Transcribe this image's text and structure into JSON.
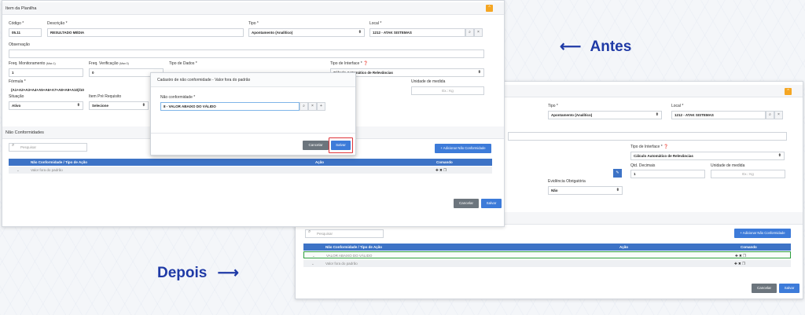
{
  "annotations": {
    "antes": "Antes",
    "depois": "Depois"
  },
  "before": {
    "section_title": "Item da Planilha",
    "labels": {
      "codigo": "Código *",
      "descricao": "Descrição *",
      "tipo": "Tipo *",
      "local": "Local *",
      "observacao": "Observação",
      "freq_monitoramento": "Freq. Monitoramento",
      "freq_monitoramento_hint": "(Max 1)",
      "freq_verificacao": "Freq. Verificação",
      "freq_verificacao_hint": "(Max 0)",
      "tipo_dados": "Tipo de Dados *",
      "tipo_interface": "Tipo de Interface *",
      "formula": "Fórmula *",
      "unidade_medida": "Unidade de medida",
      "situacao": "Situação",
      "item_pre_requisito": "Item Pré Requisito"
    },
    "values": {
      "codigo": "05.11",
      "descricao": "RESULTADO MÉDIA",
      "tipo": "Apontamento (Analítico)",
      "local": "1212 - ATAK SISTEMAS",
      "freq_monitoramento": "1",
      "freq_verificacao": "0",
      "tipo_interface": "Cálculo Automático de Relevâncias",
      "formula": "(A1+A2+A3+A4+A5+A6+A7+A8+A9+A10)/10",
      "unidade_placeholder": "Ex.: Kg",
      "situacao": "Ativo",
      "item_pre_requisito": "Selecione"
    },
    "nc_section": "Não Conformidades",
    "search_placeholder": "Pesquisar",
    "add_nc": "+ Adicionar Não Conformidade",
    "table": {
      "headers": [
        "Não Conformidade / Tipo de Ação",
        "Ação",
        "Comando"
      ],
      "rows": [
        "Valor fora do padrão"
      ]
    },
    "buttons": {
      "cancel": "Cancelar",
      "save": "Salvar"
    },
    "modal": {
      "title": "Cadastro de não conformidade - Valor fora do padrão",
      "label": "Não conformidade *",
      "value": "8 - VALOR ABAIXO DO VÁLIDO",
      "cancel": "Cancelar",
      "save": "Salvar"
    }
  },
  "after": {
    "labels": {
      "tipo": "Tipo *",
      "local": "Local *",
      "tipo_interface": "Tipo de Interface *",
      "qtd_decimais": "Qtd. Decimais",
      "unidade_medida": "Unidade de medida",
      "evidencia": "Evidência Obrigatória"
    },
    "values": {
      "tipo": "Apontamento (Analítico)",
      "local": "1212 - ATAK SISTEMAS",
      "tipo_interface": "Cálculo Automático de Relevâncias",
      "qtd_decimais": "1",
      "unidade_placeholder": "Ex.: Kg",
      "evidencia": "Não"
    },
    "search_placeholder": "Pesquisar",
    "add_nc": "+ Adicionar Não Conformidade",
    "table": {
      "headers": [
        "Não Conformidade / Tipo de Ação",
        "Ação",
        "Comando"
      ],
      "rows": [
        "VALOR ABAIXO DO VÁLIDO",
        "Valor fora do padrão"
      ]
    },
    "buttons": {
      "cancel": "Cancelar",
      "save": "Salvar"
    }
  },
  "colors": {
    "accent": "#3d73c6",
    "annotation": "#1f3aa6",
    "highlight": "#2e9e3e",
    "modal_highlight": "#e0343a"
  }
}
